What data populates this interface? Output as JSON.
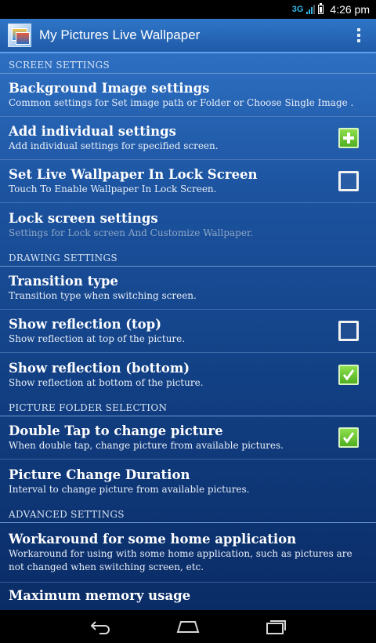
{
  "status": {
    "network": "3G",
    "time": "4:26 pm"
  },
  "actionbar": {
    "icon": "app-icon",
    "title": "My Pictures Live Wallpaper",
    "overflow_icon": "overflow-menu-icon"
  },
  "sections": {
    "screen": "SCREEN SETTINGS",
    "drawing": "DRAWING SETTINGS",
    "folder": "PICTURE FOLDER SELECTION",
    "advanced": "ADVANCED SETTINGS"
  },
  "prefs": {
    "bg_image": {
      "title": "Background Image settings",
      "summary": "Common settings for Set image path or Folder or Choose Single Image ."
    },
    "individual": {
      "title": "Add individual settings",
      "summary": "Add individual settings for specified screen.",
      "widget": "plus-icon"
    },
    "lock_wallpaper": {
      "title": "Set Live Wallpaper In Lock Screen",
      "summary": "Touch To Enable Wallpaper In Lock Screen.",
      "checked": false
    },
    "lock_settings": {
      "title": "Lock screen settings",
      "summary": "Settings for Lock screen And Customize Wallpaper.",
      "enabled": false
    },
    "transition": {
      "title": "Transition type",
      "summary": "Transition type when switching screen."
    },
    "refl_top": {
      "title": "Show reflection (top)",
      "summary": "Show reflection at top of the picture.",
      "checked": false
    },
    "refl_bottom": {
      "title": "Show reflection (bottom)",
      "summary": "Show reflection at bottom of the picture.",
      "checked": true
    },
    "double_tap": {
      "title": "Double Tap to change picture",
      "summary": "When double tap, change picture from available pictures.",
      "checked": true
    },
    "change_duration": {
      "title": "Picture Change Duration",
      "summary": "Interval to change picture from available pictures."
    },
    "workaround": {
      "title": "Workaround for some home application",
      "summary": "Workaround for using with some home application, such as pictures are not changed when switching screen, etc."
    },
    "memory": {
      "title": "Maximum memory usage"
    }
  },
  "navbar": {
    "back_icon": "back-icon",
    "home_icon": "home-icon",
    "recents_icon": "recent-apps-icon"
  },
  "colors": {
    "accent_green": "#5cc228",
    "actionbar_blue": "#2a6cc0"
  }
}
